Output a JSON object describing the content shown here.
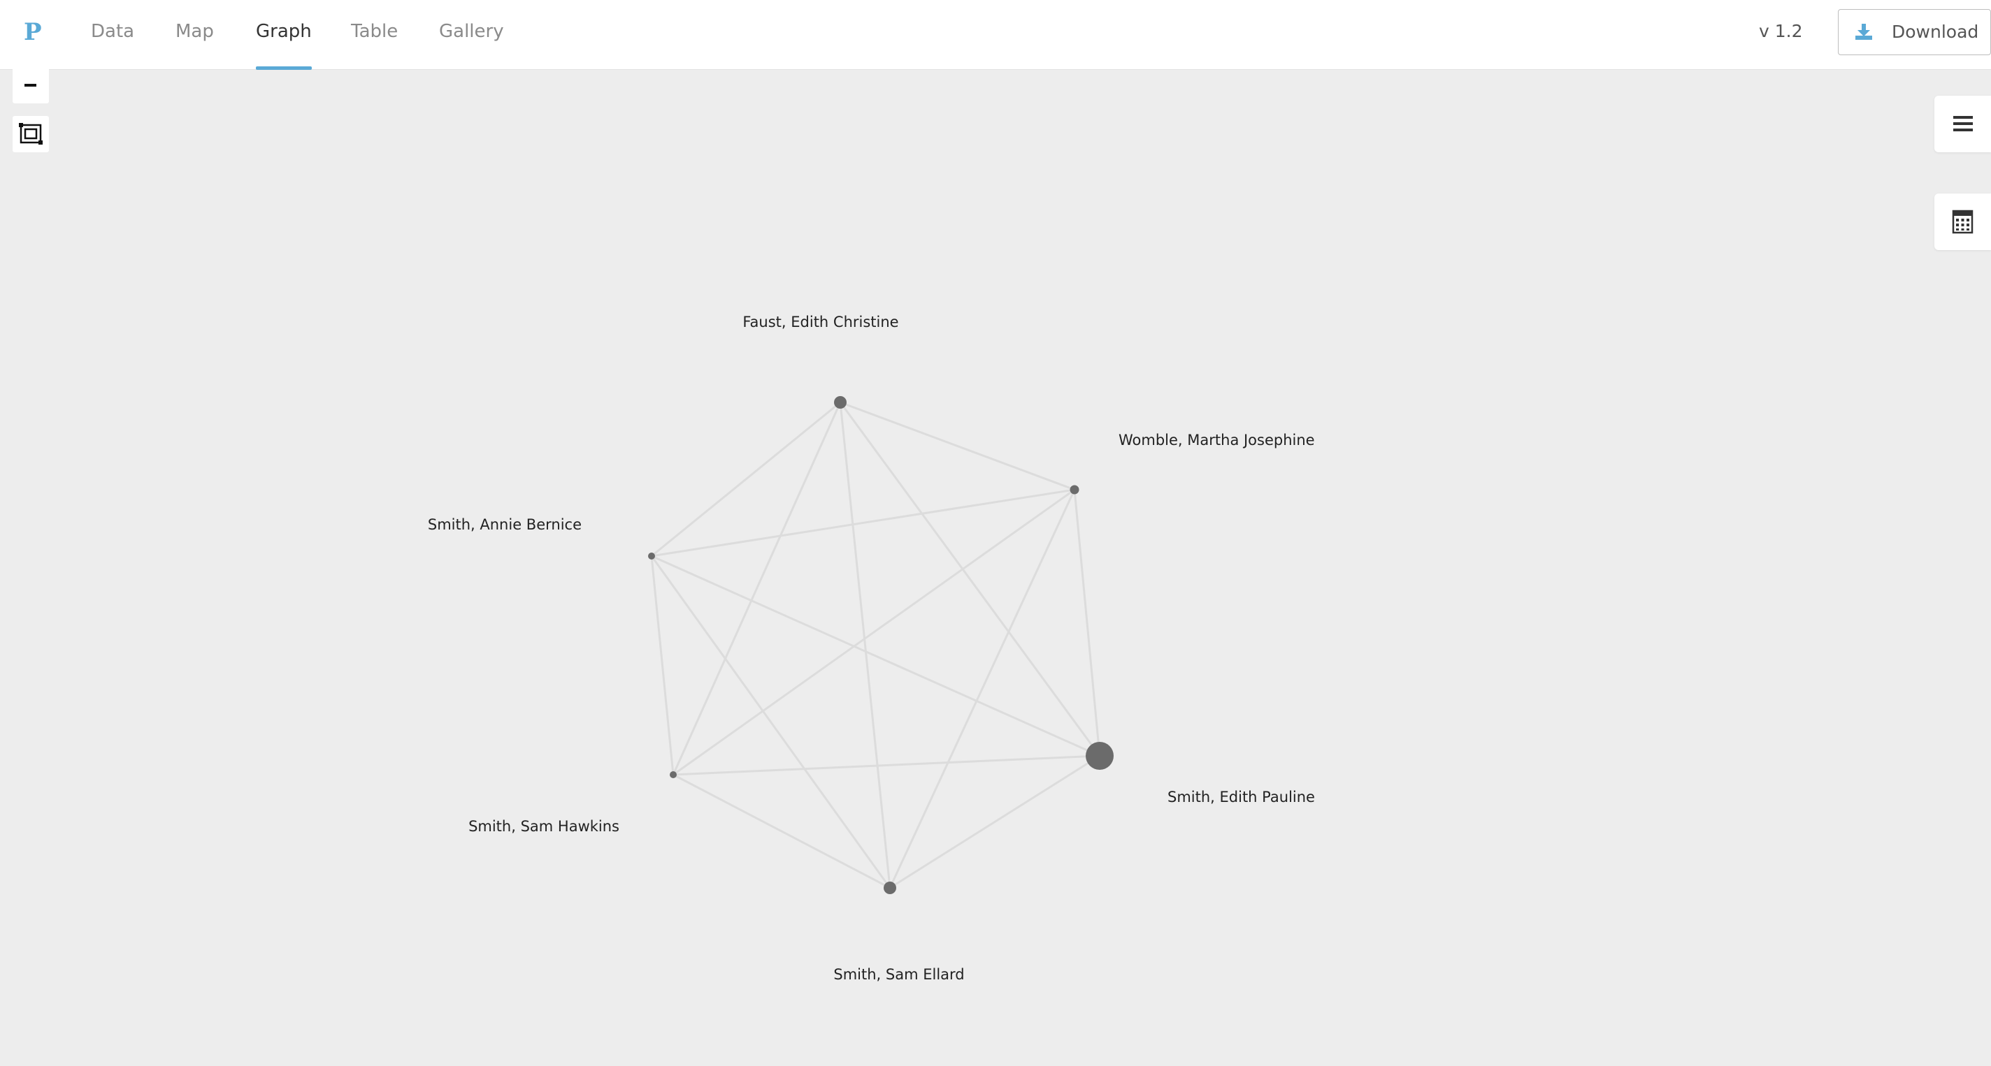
{
  "app": {
    "logo_letter": "P",
    "version": "v 1.2",
    "download_label": "Download",
    "accent_color": "#5aa9d6"
  },
  "tabs": [
    {
      "label": "Data",
      "active": false
    },
    {
      "label": "Map",
      "active": false
    },
    {
      "label": "Graph",
      "active": true
    },
    {
      "label": "Table",
      "active": false
    },
    {
      "label": "Gallery",
      "active": false
    }
  ],
  "controls": {
    "zoom_out_icon": "minus-icon",
    "fit_icon": "fit-to-screen-icon",
    "menu_icon": "hamburger-menu-icon",
    "calculator_icon": "calculator-icon"
  },
  "graph": {
    "node_color": "#6b6b6b",
    "edge_color": "#dcdcdc",
    "nodes": [
      {
        "id": "faust",
        "label": "Faust, Edith Christine",
        "size": "medium"
      },
      {
        "id": "womble",
        "label": "Womble, Martha Josephine",
        "size": "small"
      },
      {
        "id": "annie",
        "label": "Smith, Annie Bernice",
        "size": "tiny"
      },
      {
        "id": "hawkins",
        "label": "Smith, Sam Hawkins",
        "size": "tiny"
      },
      {
        "id": "ellard",
        "label": "Smith, Sam Ellard",
        "size": "medium"
      },
      {
        "id": "pauline",
        "label": "Smith, Edith Pauline",
        "size": "large"
      }
    ],
    "edges": [
      [
        "faust",
        "womble"
      ],
      [
        "faust",
        "annie"
      ],
      [
        "faust",
        "hawkins"
      ],
      [
        "faust",
        "ellard"
      ],
      [
        "faust",
        "pauline"
      ],
      [
        "womble",
        "annie"
      ],
      [
        "womble",
        "hawkins"
      ],
      [
        "womble",
        "ellard"
      ],
      [
        "womble",
        "pauline"
      ],
      [
        "annie",
        "hawkins"
      ],
      [
        "annie",
        "ellard"
      ],
      [
        "annie",
        "pauline"
      ],
      [
        "hawkins",
        "ellard"
      ],
      [
        "hawkins",
        "pauline"
      ],
      [
        "ellard",
        "pauline"
      ]
    ]
  }
}
